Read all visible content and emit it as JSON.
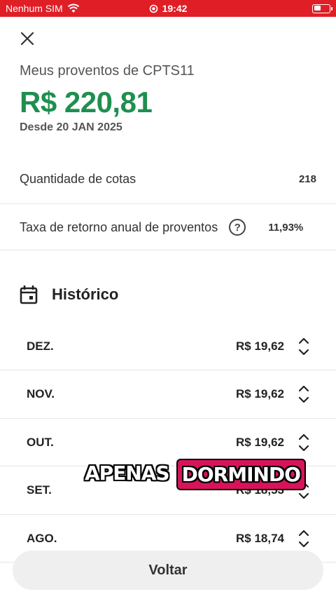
{
  "status_bar": {
    "carrier": "Nenhum SIM",
    "time": "19:42",
    "battery_level": 0.45,
    "background_color": "#e01e26"
  },
  "header": {
    "title": "Meus proventos de CPTS11",
    "total": "R$ 220,81",
    "since": "Desde 20 JAN 2025",
    "accent_color": "#1f8f4f"
  },
  "info": {
    "quantity_label": "Quantidade de cotas",
    "quantity_value": "218",
    "rate_label": "Taxa de retorno anual de proventos",
    "rate_help": "?",
    "rate_value": "11,93%"
  },
  "history": {
    "title": "Histórico",
    "rows": [
      {
        "month": "DEZ.",
        "value": "R$ 19,62"
      },
      {
        "month": "NOV.",
        "value": "R$ 19,62"
      },
      {
        "month": "OUT.",
        "value": "R$ 19,62"
      },
      {
        "month": "SET.",
        "value": "R$ 18,53"
      },
      {
        "month": "AGO.",
        "value": "R$ 18,74"
      }
    ]
  },
  "caption": {
    "word1": "APENAS",
    "word2": "DORMINDO",
    "highlight_color": "#d8135b"
  },
  "footer": {
    "back_label": "Voltar"
  }
}
